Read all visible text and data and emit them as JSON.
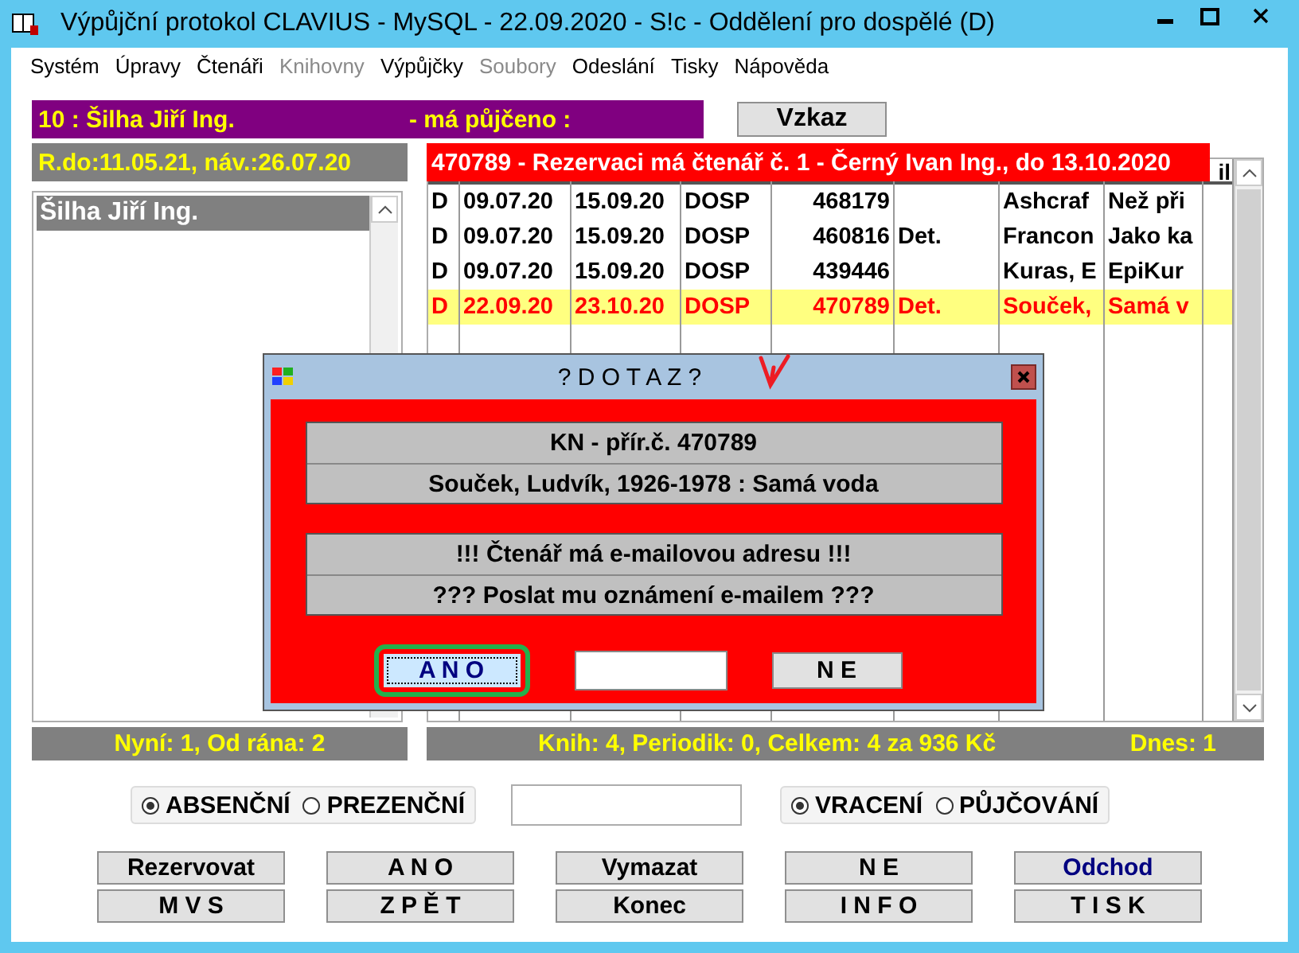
{
  "window": {
    "title": "Výpůjční protokol CLAVIUS - MySQL - 22.09.2020 - S!c - Oddělení pro dospělé (D)"
  },
  "menu": [
    {
      "label": "Systém",
      "disabled": false
    },
    {
      "label": "Úpravy",
      "disabled": false
    },
    {
      "label": "Čtenáři",
      "disabled": false
    },
    {
      "label": "Knihovny",
      "disabled": true
    },
    {
      "label": "Výpůjčky",
      "disabled": false
    },
    {
      "label": "Soubory",
      "disabled": true
    },
    {
      "label": "Odeslání",
      "disabled": false
    },
    {
      "label": "Tisky",
      "disabled": false
    },
    {
      "label": "Nápověda",
      "disabled": false
    }
  ],
  "reader": {
    "header": "10 : Šilha Jiří Ing.",
    "loan_label": "- má půjčeno :",
    "dates": "R.do:11.05.21, náv.:26.07.20"
  },
  "message_button": "Vzkaz",
  "reader_list": [
    {
      "name": "Šilha Jiří Ing.",
      "selected": true
    }
  ],
  "reservation_banner": "470789 - Rezervaci má čtenář č. 1 - Černý Ivan Ing., do 13.10.2020",
  "loans": {
    "header_fragment": "il",
    "rows": [
      {
        "highlighted": false,
        "cells": [
          "D",
          "09.07.20",
          "15.09.20",
          "DOSP",
          "468179",
          null,
          "Ashcraf",
          "Než při"
        ]
      },
      {
        "highlighted": false,
        "cells": [
          "D",
          "09.07.20",
          "15.09.20",
          "DOSP",
          "460816",
          "Det.",
          "Francon",
          "Jako ka"
        ]
      },
      {
        "highlighted": false,
        "cells": [
          "D",
          "09.07.20",
          "15.09.20",
          "DOSP",
          "439446",
          null,
          "Kuras, E",
          "EpiKur"
        ]
      },
      {
        "highlighted": true,
        "cells": [
          "D",
          "22.09.20",
          "23.10.20",
          "DOSP",
          "470789",
          "Det.",
          "Souček,",
          "Samá v"
        ]
      }
    ]
  },
  "status": {
    "left": "Nyní: 1, Od rána: 2",
    "middle": "Knih: 4, Periodik: 0, Celkem: 4 za 936 Kč",
    "right": "Dnes: 1"
  },
  "loan_type": [
    {
      "label": "ABSENČNÍ",
      "selected": true
    },
    {
      "label": "PREZENČNÍ",
      "selected": false
    }
  ],
  "mode": [
    {
      "label": "VRACENÍ",
      "selected": true
    },
    {
      "label": "PŮJČOVÁNÍ",
      "selected": false
    }
  ],
  "buttons": [
    {
      "label": "Rezervovat",
      "kind": "normal"
    },
    {
      "label": "A N O",
      "kind": "normal"
    },
    {
      "label": "Vymazat",
      "kind": "normal"
    },
    {
      "label": "N E",
      "kind": "normal"
    },
    {
      "label": "Odchod",
      "kind": "accent"
    },
    {
      "label": "M V S",
      "kind": "normal"
    },
    {
      "label": "Z P Ě T",
      "kind": "normal"
    },
    {
      "label": "Konec",
      "kind": "normal"
    },
    {
      "label": "I N F O",
      "kind": "normal"
    },
    {
      "label": "T I S K",
      "kind": "normal"
    }
  ],
  "dialog": {
    "title": "? D O T A Z ?",
    "groups": [
      [
        "KN - přír.č. 470789",
        "Souček, Ludvík, 1926-1978 : Samá voda"
      ],
      [
        "!!! Čtenář má e-mailovou adresu !!!",
        "??? Poslat mu oznámení e-mailem ???"
      ]
    ],
    "buttons": [
      {
        "label": "A N O",
        "focused": true
      },
      {
        "label": "N E",
        "focused": false
      }
    ]
  }
}
